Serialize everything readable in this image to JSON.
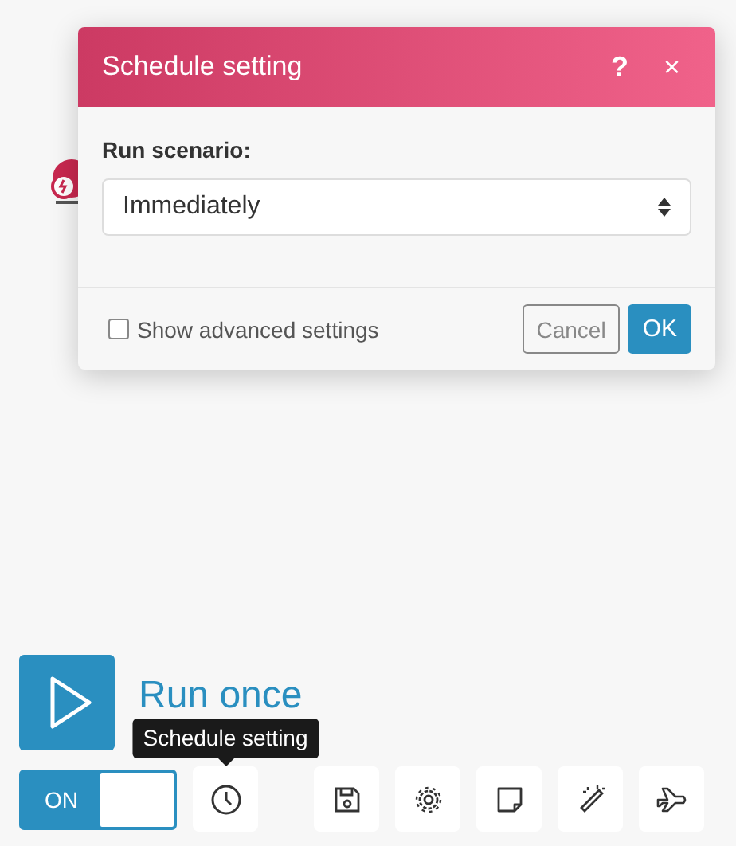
{
  "dialog": {
    "title": "Schedule setting",
    "help": "?",
    "close": "×",
    "field_label": "Run scenario:",
    "select": {
      "value": "Immediately"
    },
    "advanced": {
      "label": "Show advanced settings",
      "checked": false
    },
    "buttons": [
      {
        "label": "Cancel",
        "kind": "secondary"
      },
      {
        "label": "OK",
        "kind": "primary"
      }
    ]
  },
  "run": {
    "label": "Run once"
  },
  "toggle": {
    "label": "ON",
    "on": true
  },
  "tooltip": "Schedule setting"
}
